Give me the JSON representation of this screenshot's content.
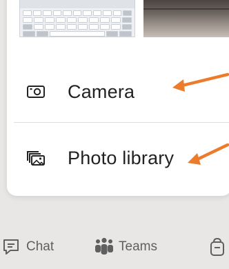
{
  "sheet": {
    "options": [
      {
        "label": "Camera",
        "icon": "camera-icon"
      },
      {
        "label": "Photo library",
        "icon": "photo-library-icon"
      }
    ],
    "recent_thumbnails": [
      "keyboard-screenshot",
      "laptop-photo"
    ]
  },
  "annotations": {
    "arrow_color": "#ec7b2c"
  },
  "tabbar": {
    "tabs": [
      {
        "label": "Chat",
        "icon": "chat-icon"
      },
      {
        "label": "Teams",
        "icon": "teams-icon"
      },
      {
        "label": "",
        "icon": "bag-icon"
      }
    ]
  },
  "colors": {
    "background": "#e9e7e5",
    "sheet": "#ffffff",
    "tab_text": "#5f5f5f"
  }
}
